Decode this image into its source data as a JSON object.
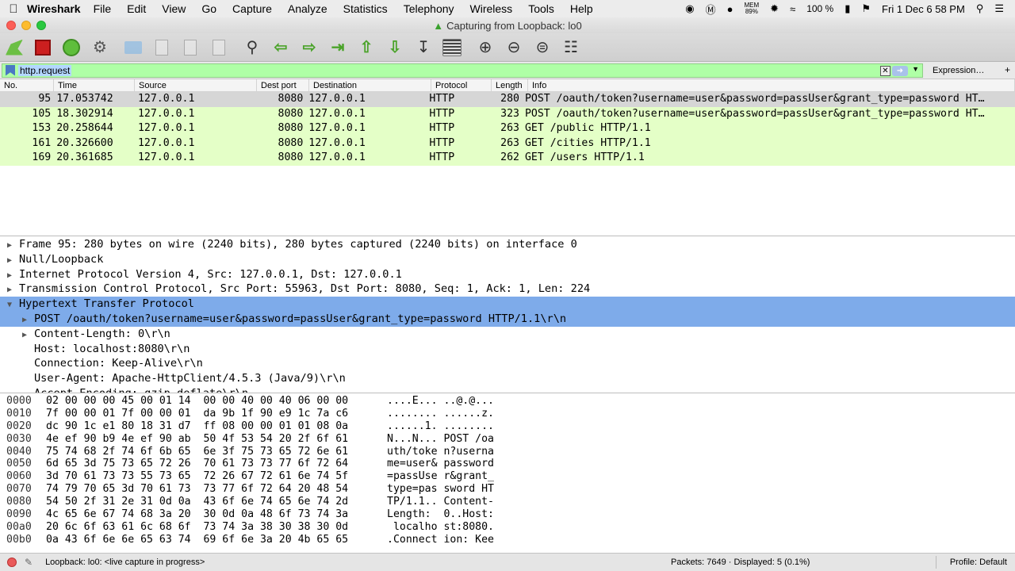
{
  "menubar": {
    "app_name": "Wireshark",
    "items": [
      "File",
      "Edit",
      "View",
      "Go",
      "Capture",
      "Analyze",
      "Statistics",
      "Telephony",
      "Wireless",
      "Tools",
      "Help"
    ],
    "status_mem_label": "MEM",
    "status_mem_pct": "89%",
    "battery": "100 %",
    "clock": "Fri 1 Dec  6 58 PM"
  },
  "window": {
    "title": "Capturing from Loopback: lo0"
  },
  "filter": {
    "value": "http.request",
    "expression_label": "Expression…",
    "plus_label": "+"
  },
  "packet_list": {
    "columns": [
      "No.",
      "Time",
      "Source",
      "Dest port",
      "Destination",
      "Protocol",
      "Length",
      "Info"
    ],
    "rows": [
      {
        "no": "95",
        "time": "17.053742",
        "src": "127.0.0.1",
        "dport": "8080",
        "dst": "127.0.0.1",
        "proto": "HTTP",
        "len": "280",
        "info": "POST /oauth/token?username=user&password=passUser&grant_type=password HT…"
      },
      {
        "no": "105",
        "time": "18.302914",
        "src": "127.0.0.1",
        "dport": "8080",
        "dst": "127.0.0.1",
        "proto": "HTTP",
        "len": "323",
        "info": "POST /oauth/token?username=user&password=passUser&grant_type=password HT…"
      },
      {
        "no": "153",
        "time": "20.258644",
        "src": "127.0.0.1",
        "dport": "8080",
        "dst": "127.0.0.1",
        "proto": "HTTP",
        "len": "263",
        "info": "GET /public HTTP/1.1"
      },
      {
        "no": "161",
        "time": "20.326600",
        "src": "127.0.0.1",
        "dport": "8080",
        "dst": "127.0.0.1",
        "proto": "HTTP",
        "len": "263",
        "info": "GET /cities HTTP/1.1"
      },
      {
        "no": "169",
        "time": "20.361685",
        "src": "127.0.0.1",
        "dport": "8080",
        "dst": "127.0.0.1",
        "proto": "HTTP",
        "len": "262",
        "info": "GET /users HTTP/1.1"
      }
    ]
  },
  "details": {
    "frame": "Frame 95: 280 bytes on wire (2240 bits), 280 bytes captured (2240 bits) on interface 0",
    "null_loopback": "Null/Loopback",
    "ip": "Internet Protocol Version 4, Src: 127.0.0.1, Dst: 127.0.0.1",
    "tcp": "Transmission Control Protocol, Src Port: 55963, Dst Port: 8080, Seq: 1, Ack: 1, Len: 224",
    "http": "Hypertext Transfer Protocol",
    "http_request_line": "POST /oauth/token?username=user&password=passUser&grant_type=password HTTP/1.1\\r\\n",
    "content_length": "Content-Length: 0\\r\\n",
    "host": "Host: localhost:8080\\r\\n",
    "connection": "Connection: Keep-Alive\\r\\n",
    "user_agent": "User-Agent: Apache-HttpClient/4.5.3 (Java/9)\\r\\n",
    "accept_encoding": "Accept-Encoding: gzip,deflate\\r\\n"
  },
  "hex": {
    "rows": [
      {
        "off": "0000",
        "bytes": "02 00 00 00 45 00 01 14  00 00 40 00 40 06 00 00",
        "ascii": "....E... ..@.@..."
      },
      {
        "off": "0010",
        "bytes": "7f 00 00 01 7f 00 00 01  da 9b 1f 90 e9 1c 7a c6",
        "ascii": "........ ......z."
      },
      {
        "off": "0020",
        "bytes": "dc 90 1c e1 80 18 31 d7  ff 08 00 00 01 01 08 0a",
        "ascii": "......1. ........"
      },
      {
        "off": "0030",
        "bytes": "4e ef 90 b9 4e ef 90 ab  50 4f 53 54 20 2f 6f 61",
        "ascii": "N...N... POST /oa"
      },
      {
        "off": "0040",
        "bytes": "75 74 68 2f 74 6f 6b 65  6e 3f 75 73 65 72 6e 61",
        "ascii": "uth/toke n?userna"
      },
      {
        "off": "0050",
        "bytes": "6d 65 3d 75 73 65 72 26  70 61 73 73 77 6f 72 64",
        "ascii": "me=user& password"
      },
      {
        "off": "0060",
        "bytes": "3d 70 61 73 73 55 73 65  72 26 67 72 61 6e 74 5f",
        "ascii": "=passUse r&grant_"
      },
      {
        "off": "0070",
        "bytes": "74 79 70 65 3d 70 61 73  73 77 6f 72 64 20 48 54",
        "ascii": "type=pas sword HT"
      },
      {
        "off": "0080",
        "bytes": "54 50 2f 31 2e 31 0d 0a  43 6f 6e 74 65 6e 74 2d",
        "ascii": "TP/1.1.. Content-"
      },
      {
        "off": "0090",
        "bytes": "4c 65 6e 67 74 68 3a 20  30 0d 0a 48 6f 73 74 3a",
        "ascii": "Length:  0..Host:"
      },
      {
        "off": "00a0",
        "bytes": "20 6c 6f 63 61 6c 68 6f  73 74 3a 38 30 38 30 0d",
        "ascii": " localho st:8080."
      },
      {
        "off": "00b0",
        "bytes": "0a 43 6f 6e 6e 65 63 74  69 6f 6e 3a 20 4b 65 65",
        "ascii": ".Connect ion: Kee"
      }
    ]
  },
  "status": {
    "capture_text": "Loopback: lo0: <live capture in progress>",
    "packets_text": "Packets: 7649 · Displayed: 5 (0.1%)",
    "profile_text": "Profile: Default"
  }
}
